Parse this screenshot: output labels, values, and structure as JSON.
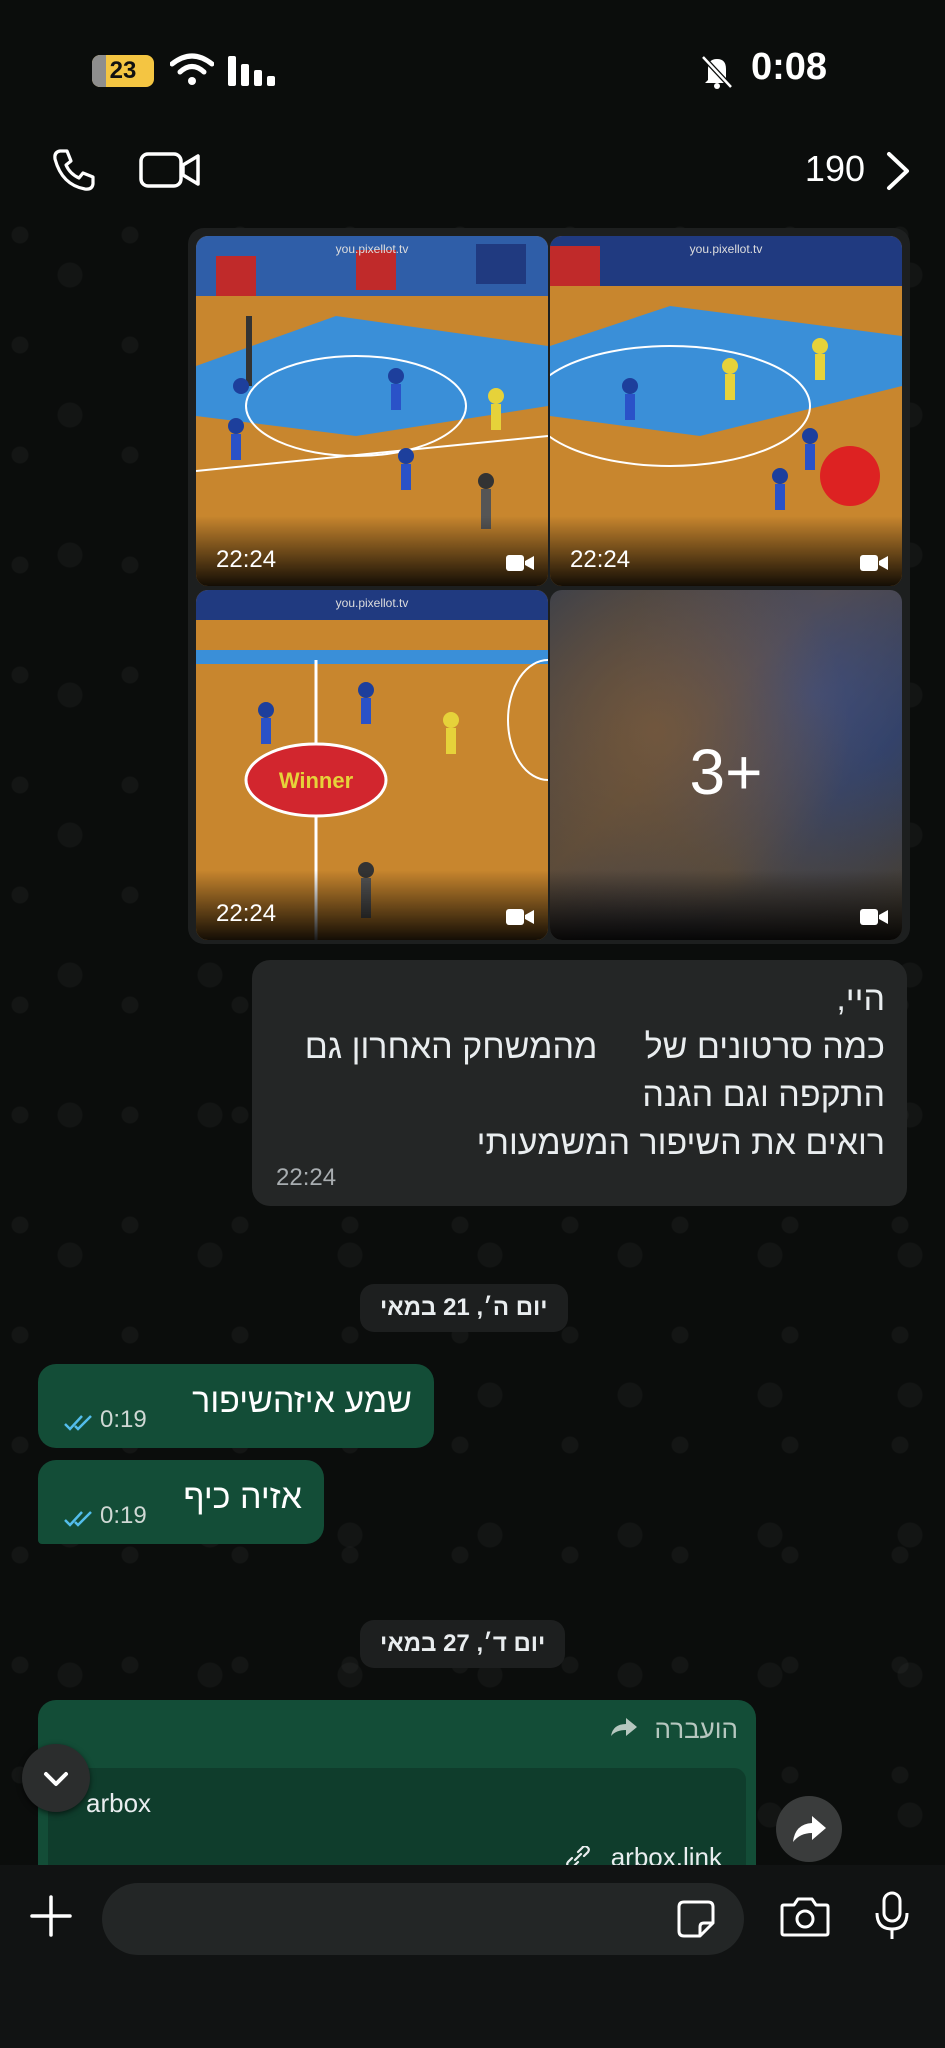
{
  "status_bar": {
    "battery_level": "23",
    "battery_fraction": 0.23,
    "time": "0:08"
  },
  "header": {
    "count": "190"
  },
  "media_album": {
    "tiles": [
      {
        "source": "you.pixellot.tv",
        "time": "22:24"
      },
      {
        "source": "you.pixellot.tv",
        "time": "22:24"
      },
      {
        "source": "you.pixellot.tv",
        "time": "22:24",
        "court_logo": "Winner"
      },
      {
        "more": "3+"
      }
    ]
  },
  "incoming_message": {
    "lines": [
      "היי,",
      "כמה סרטונים של     מהמשחק האחרון גם",
      "התקפה וגם הגנה",
      "רואים את השיפור המשמעותי"
    ],
    "time": "22:24"
  },
  "date_separators": [
    "יום ה׳, 21 במאי",
    "יום ד׳, 27 במאי"
  ],
  "outgoing_messages": [
    {
      "text": "שמע איזהשיפור",
      "time": "0:19"
    },
    {
      "text": "אזיה כיף",
      "time": "0:19"
    }
  ],
  "forwarded": {
    "label": "הועברה",
    "title": "arbox",
    "link": "arbox.link"
  },
  "composer": {
    "placeholder": ""
  },
  "colors": {
    "outgoing_bubble": "#134d37",
    "incoming_bubble": "#242626",
    "read_ticks": "#53bdeb",
    "battery_bg": "#f4c542"
  }
}
